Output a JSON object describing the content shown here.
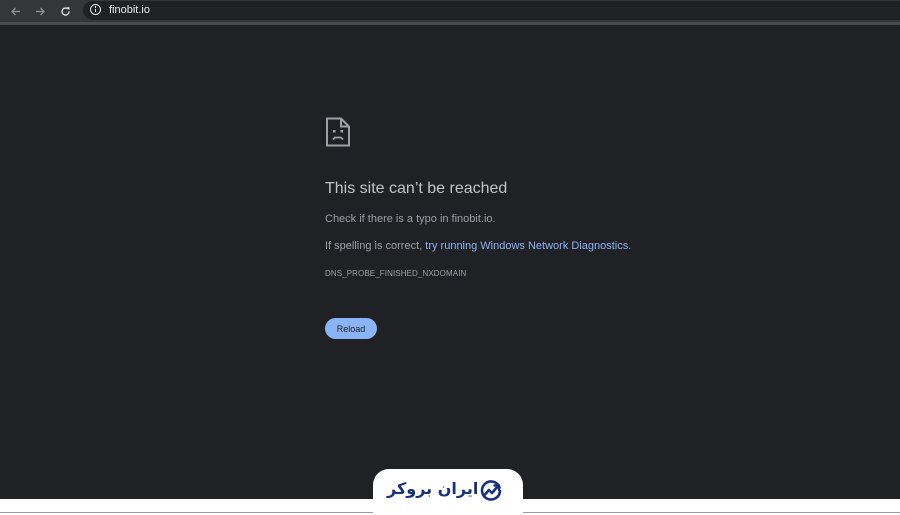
{
  "browser": {
    "back_icon": "back-arrow-icon",
    "forward_icon": "forward-arrow-icon",
    "reload_icon": "reload-icon",
    "info_icon": "info-icon",
    "url": "finobit.io"
  },
  "error_page": {
    "icon": "sad-page-icon",
    "title": "This site can’t be reached",
    "line1": "Check if there is a typo in finobit.io.",
    "line2_prefix": "If spelling is correct, ",
    "line2_link": "try running Windows Network Diagnostics",
    "line2_suffix": ".",
    "error_code": "DNS_PROBE_FINISHED_NXDOMAIN",
    "reload_label": "Reload"
  },
  "watermark": {
    "logo_icon": "chart-trend-logo-icon",
    "text": "ایران بروکر"
  },
  "colors": {
    "page_bg": "#202124",
    "text": "#9aa0a6",
    "link": "#8ab4f8",
    "button_bg": "#8ab4f8",
    "logo": "#16327a"
  }
}
